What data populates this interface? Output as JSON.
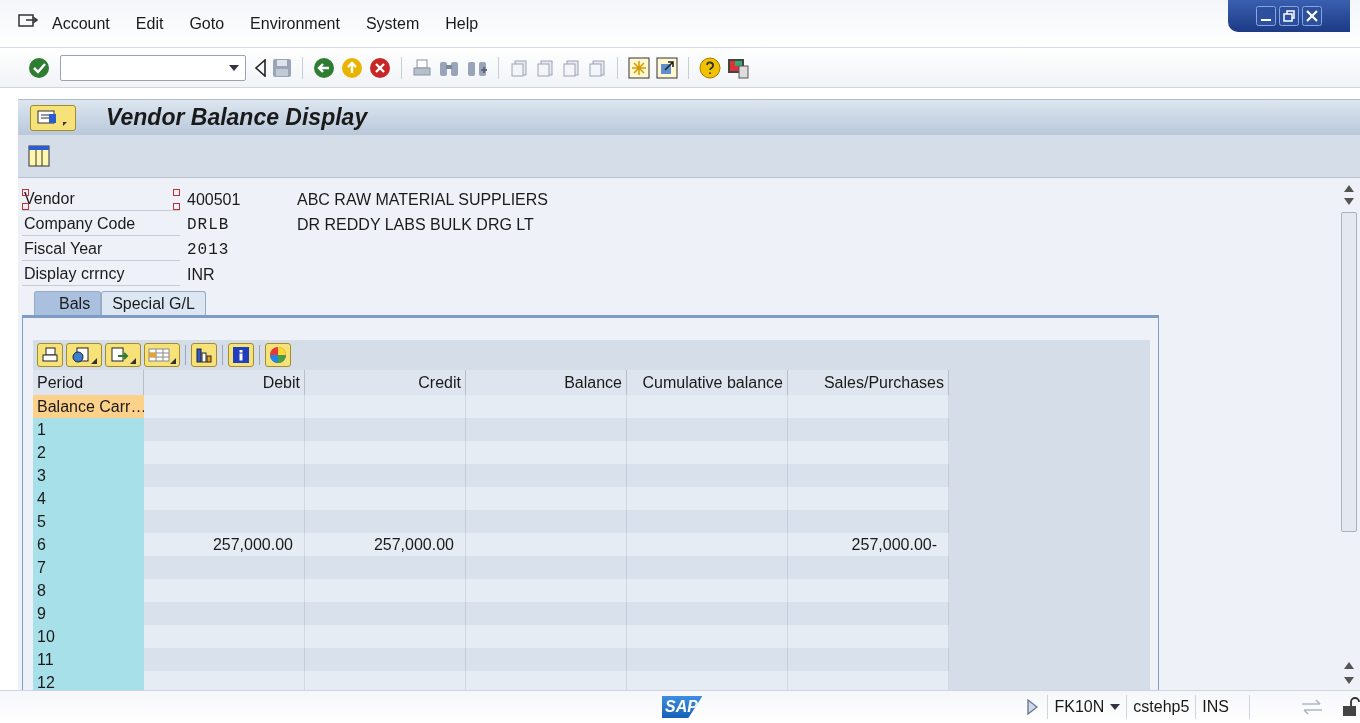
{
  "menu": [
    {
      "label": "Account"
    },
    {
      "label": "Edit"
    },
    {
      "label": "Goto"
    },
    {
      "label": "Environment"
    },
    {
      "label": "System"
    },
    {
      "label": "Help"
    }
  ],
  "title": "Vendor Balance Display",
  "fields": [
    {
      "label": "Vendor",
      "value": "400501",
      "description": "ABC RAW MATERIAL SUPPLIERS",
      "kind": "plain",
      "focused": true
    },
    {
      "label": "Company Code",
      "value": "DRLB",
      "description": "DR REDDY LABS BULK DRG LT",
      "kind": "mono",
      "focused": false
    },
    {
      "label": "Fiscal Year",
      "value": "2013",
      "kind": "mono",
      "focused": false
    },
    {
      "label": "Display crrncy",
      "value": "INR",
      "kind": "plain",
      "focused": false
    }
  ],
  "tabs": [
    {
      "label": "Bals",
      "selected": true
    },
    {
      "label": "Special G/L",
      "selected": false
    }
  ],
  "table": {
    "columns": [
      "Period",
      "Debit",
      "Credit",
      "Balance",
      "Cumulative balance",
      "Sales/Purchases"
    ],
    "rows": [
      {
        "period": "Balance Carr…",
        "selected": true
      },
      {
        "period": "1",
        "selected": false
      },
      {
        "period": "2",
        "selected": false
      },
      {
        "period": "3",
        "selected": false
      },
      {
        "period": "4",
        "selected": false
      },
      {
        "period": "5",
        "selected": false
      },
      {
        "period": "6",
        "debit": "257,000.00",
        "credit": "257,000.00",
        "sales": "257,000.00-",
        "selected": false
      },
      {
        "period": "7",
        "selected": false
      },
      {
        "period": "8",
        "selected": false
      },
      {
        "period": "9",
        "selected": false
      },
      {
        "period": "10",
        "selected": false
      },
      {
        "period": "11",
        "selected": false
      },
      {
        "period": "12",
        "selected": false
      }
    ]
  },
  "status_bar": {
    "logo": "SAP",
    "transaction": "FK10N",
    "server": "cstehp5",
    "mode": "INS"
  }
}
